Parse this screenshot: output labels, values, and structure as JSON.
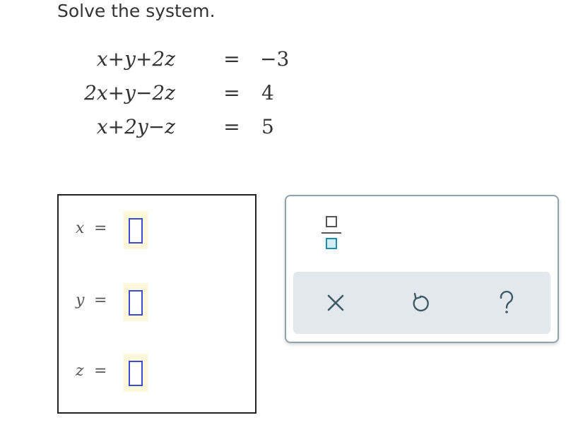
{
  "prompt": "Solve the system.",
  "system": {
    "equations": [
      {
        "lhs": "x+y+2z",
        "eq": "=",
        "rhs": "−3"
      },
      {
        "lhs": "2x+y−2z",
        "eq": "=",
        "rhs": "4"
      },
      {
        "lhs": "x+2y−z",
        "eq": "=",
        "rhs": "5"
      }
    ]
  },
  "answers": [
    {
      "var": "x",
      "eq": "=",
      "value": ""
    },
    {
      "var": "y",
      "eq": "=",
      "value": ""
    },
    {
      "var": "z",
      "eq": "=",
      "value": ""
    }
  ],
  "toolbar": {
    "fraction_icon": "fraction-template-icon",
    "clear_icon": "close-x-icon",
    "undo_icon": "undo-icon",
    "help_icon": "question-mark-icon"
  },
  "colors": {
    "slot_border": "#3b4bd6",
    "slot_highlight": "#fdf8d9",
    "panel_border": "#8fa3ad",
    "action_bar_bg": "#e2e8eb",
    "icon_color": "#3d5a66"
  }
}
